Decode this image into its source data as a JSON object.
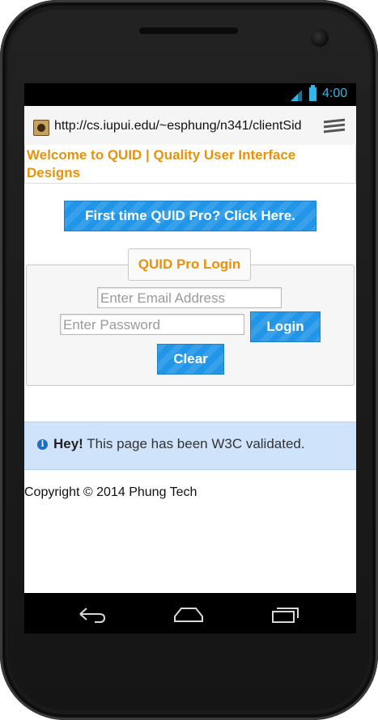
{
  "statusbar": {
    "time": "4:00"
  },
  "browser": {
    "url": "http://cs.iupui.edu/~esphung/n341/clientSid"
  },
  "page": {
    "header_title": "Welcome to QUID | Quality User Interface Designs",
    "cta_label": "First time QUID Pro? Click Here.",
    "login_form": {
      "legend": "QUID Pro Login",
      "email_placeholder": "Enter Email Address",
      "password_placeholder": "Enter Password",
      "login_label": "Login",
      "clear_label": "Clear"
    },
    "alert": {
      "strong": "Hey!",
      "text": " This page has been W3C validated."
    },
    "copyright": "Copyright © 2014 Phung Tech"
  },
  "colors": {
    "accent": "#e8920c",
    "button": "#2196e8",
    "alert_bg": "#cfe3fa",
    "status": "#33b5e5"
  },
  "icons": [
    "signal-icon",
    "battery-icon",
    "favicon-icon",
    "menu-icon",
    "info-icon",
    "back-icon",
    "home-icon",
    "recent-apps-icon"
  ]
}
